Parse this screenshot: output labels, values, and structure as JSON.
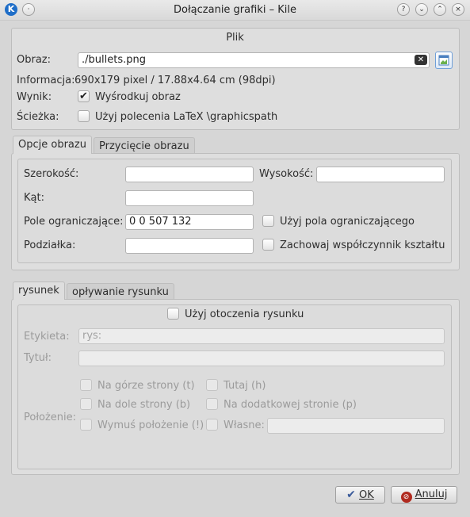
{
  "window": {
    "title": "Dołączanie grafiki – Kile",
    "app_icon": "K",
    "buttons": [
      "?",
      "⌄",
      "⌃",
      "×"
    ]
  },
  "file": {
    "group_title": "Plik",
    "image_label": "Obraz:",
    "image_value": "./bullets.png",
    "info_label": "Informacja:",
    "info_value": "690x179 pixel / 17.88x4.64 cm  (98dpi)",
    "result_label": "Wynik:",
    "center_label": "Wyśrodkuj obraz",
    "center_checked": true,
    "path_label": "Ścieżka:",
    "graphicspath_label": "Użyj polecenia LaTeX \\graphicspath",
    "graphicspath_checked": false
  },
  "image_tabs": [
    "Opcje obrazu",
    "Przycięcie obrazu"
  ],
  "image_options": {
    "width_label": "Szerokość:",
    "width_value": "",
    "height_label": "Wysokość:",
    "height_value": "",
    "angle_label": "Kąt:",
    "angle_value": "",
    "bbox_label": "Pole ograniczające:",
    "bbox_value": "0 0 507 132",
    "use_bbox_label": "Użyj pola ograniczającego",
    "scale_label": "Podziałka:",
    "scale_value": "",
    "keep_aspect_label": "Zachowaj współczynnik kształtu"
  },
  "figure_tabs": [
    "rysunek",
    "opływanie rysunku"
  ],
  "figure": {
    "use_env_label": "Użyj otoczenia rysunku",
    "label_label": "Etykieta:",
    "label_placeholder": "rys:",
    "caption_label": "Tytuł:",
    "placement_label": "Położenie:",
    "opt_top": "Na górze strony (t)",
    "opt_here": "Tutaj (h)",
    "opt_bottom": "Na dole strony (b)",
    "opt_page": "Na dodatkowej stronie (p)",
    "opt_force": "Wymuś położenie (!)",
    "opt_custom": "Własne:"
  },
  "footer": {
    "ok_label": "OK",
    "cancel_label": "Anuluj"
  },
  "colors": {
    "ok_check": "#3a5a9a",
    "cancel_icon": "#b02a1f",
    "app_icon": "#1f6ec8"
  },
  "icons": [
    "kile-app-icon",
    "clear-field-icon",
    "open-file-icon",
    "ok-check-icon",
    "cancel-icon"
  ]
}
